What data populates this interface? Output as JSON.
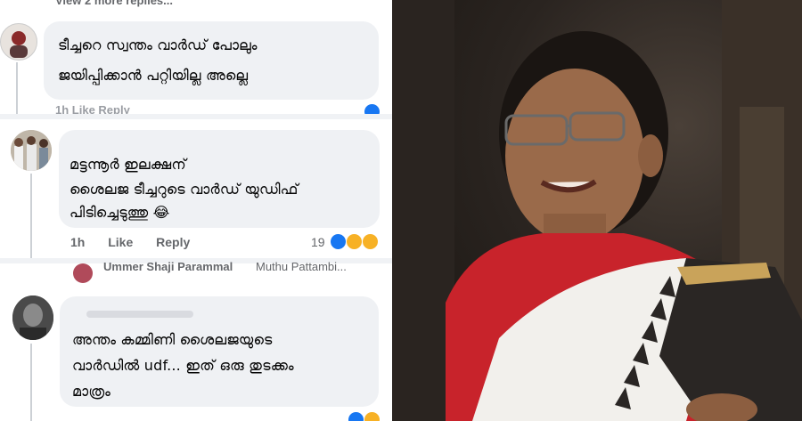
{
  "top_cut_text": "View 2 more replies...",
  "comments": [
    {
      "line1": "ടീച്ചറെ സ്വന്തം വാർഡ് പോലും",
      "line2": "ജയിപ്പിക്കാൻ പറ്റിയില്ല അല്ലെ",
      "meta_cut": "1h   Like   Reply"
    },
    {
      "line1": "മട്ടന്നൂർ ഇലക്ഷന്",
      "line2": "ശൈലജ ടീച്ചറുടെ വാർഡ് യുഡിഫ്",
      "line3": "പിടിച്ചെടുത്തു 😂",
      "time": "1h",
      "like": "Like",
      "reply": "Reply",
      "reaction_count": "19"
    },
    {
      "author_cut": "Ummer Shaji Parammal",
      "author_sub": "Muthu Pattambi..."
    },
    {
      "line1": "അന്തം കമ്മിണി ശൈലജയുടെ",
      "line2": "വാർഡിൽ udf... ഇത് ഒരു തുടക്കം",
      "line3": "മാത്രം"
    }
  ],
  "colors": {
    "bubble": "#eff1f4",
    "meta_text": "#65676b",
    "like_blue": "#1877f2",
    "haha_yellow": "#f7b125",
    "saree_red": "#c8232b"
  }
}
